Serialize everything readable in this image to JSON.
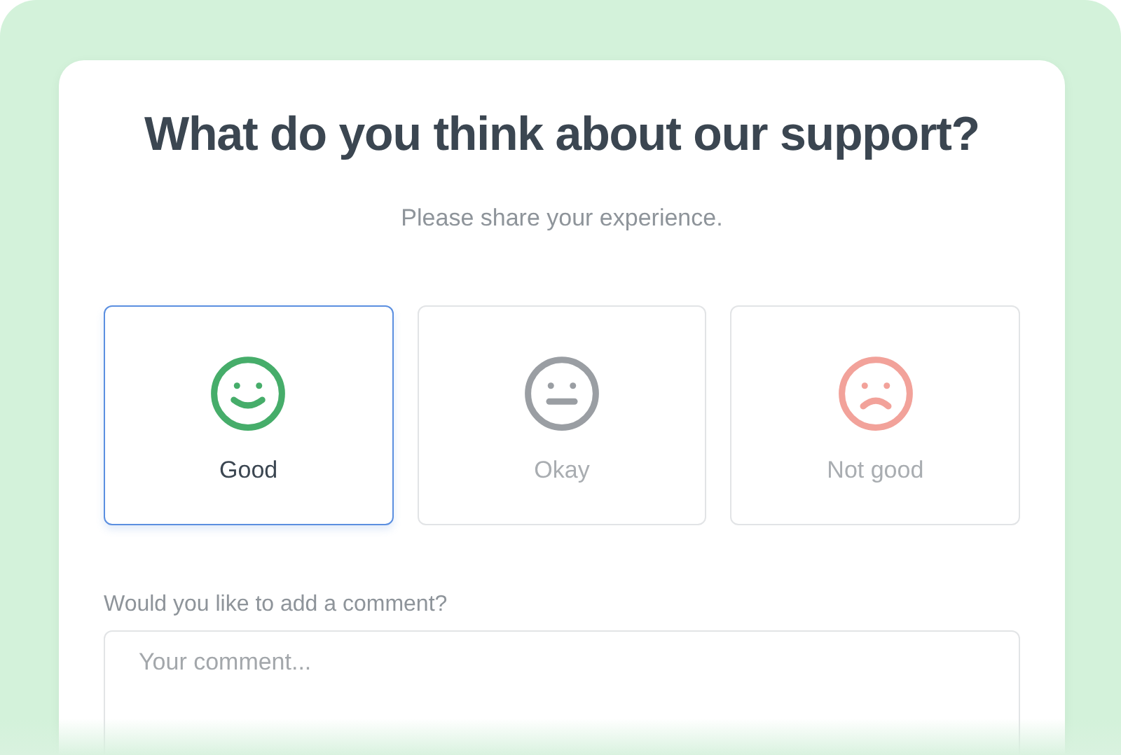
{
  "title": "What do you think about our support?",
  "subtitle": "Please share your experience.",
  "options": [
    {
      "label": "Good",
      "kind": "good",
      "selected": true
    },
    {
      "label": "Okay",
      "kind": "okay",
      "selected": false
    },
    {
      "label": "Not good",
      "kind": "bad",
      "selected": false
    }
  ],
  "comment": {
    "label": "Would you like to add a comment?",
    "placeholder": "Your comment..."
  }
}
